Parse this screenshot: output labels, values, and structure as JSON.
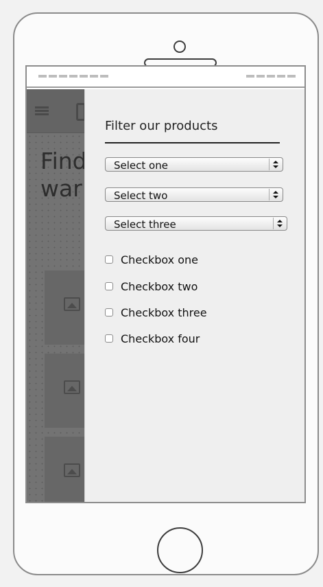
{
  "screen": {
    "background_heading": "Find\nwar"
  },
  "filter_panel": {
    "title": "Filter our products",
    "selects": [
      {
        "value": "Select one"
      },
      {
        "value": "Select two"
      },
      {
        "value": "Select three"
      }
    ],
    "checkboxes": [
      {
        "label": "Checkbox one",
        "checked": false
      },
      {
        "label": "Checkbox two",
        "checked": false
      },
      {
        "label": "Checkbox three",
        "checked": false
      },
      {
        "label": "Checkbox four",
        "checked": false
      }
    ]
  },
  "icons": {
    "menu": "hamburger-icon",
    "image": "image-placeholder-icon",
    "select_arrow": "select-arrow-icon"
  },
  "colors": {
    "device_frame": "#8a8a8a",
    "overlay_background": "#747474",
    "panel_background": "#efefef"
  }
}
